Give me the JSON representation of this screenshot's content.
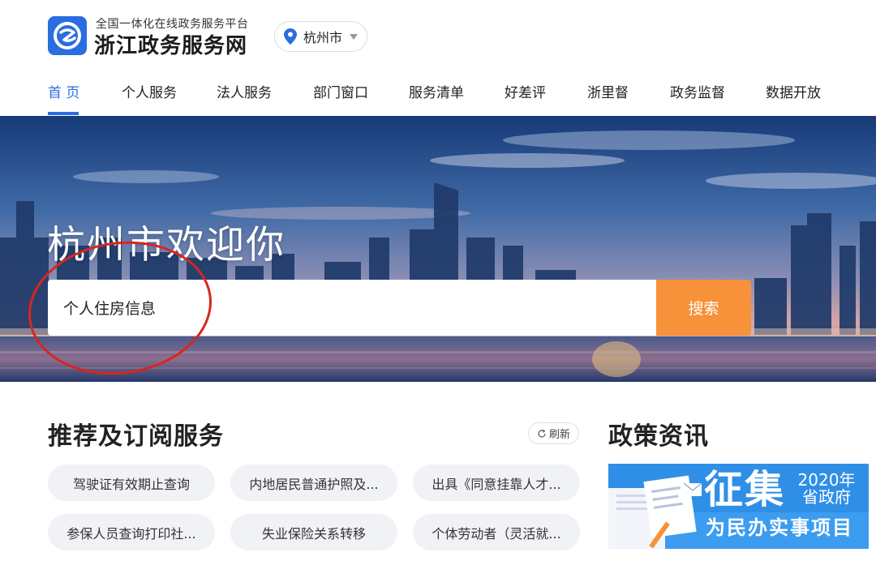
{
  "header": {
    "platform_subtitle": "全国一体化在线政务服务平台",
    "site_title": "浙江政务服务网",
    "city": "杭州市",
    "logo_icon": "zhejiang-gov-logo",
    "accent_color": "#2a6de0"
  },
  "nav": {
    "items": [
      {
        "label": "首 页",
        "active": true
      },
      {
        "label": "个人服务"
      },
      {
        "label": "法人服务"
      },
      {
        "label": "部门窗口"
      },
      {
        "label": "服务清单"
      },
      {
        "label": "好差评"
      },
      {
        "label": "浙里督"
      },
      {
        "label": "政务监督"
      },
      {
        "label": "数据开放"
      }
    ]
  },
  "banner": {
    "welcome": "杭州市欢迎你",
    "search_value": "个人住房信息",
    "search_button": "搜索",
    "search_button_color": "#f7913a"
  },
  "recommend": {
    "title": "推荐及订阅服务",
    "refresh_label": "刷新",
    "items": [
      "驾驶证有效期止查询",
      "内地居民普通护照及...",
      "出具《同意挂靠人才...",
      "参保人员查询打印社...",
      "失业保险关系转移",
      "个体劳动者（灵活就..."
    ]
  },
  "policy": {
    "title": "政策资讯",
    "banner_big": "征集",
    "banner_year": "2020年",
    "banner_gov": "省政府",
    "banner_sub": "为民办实事项目"
  }
}
